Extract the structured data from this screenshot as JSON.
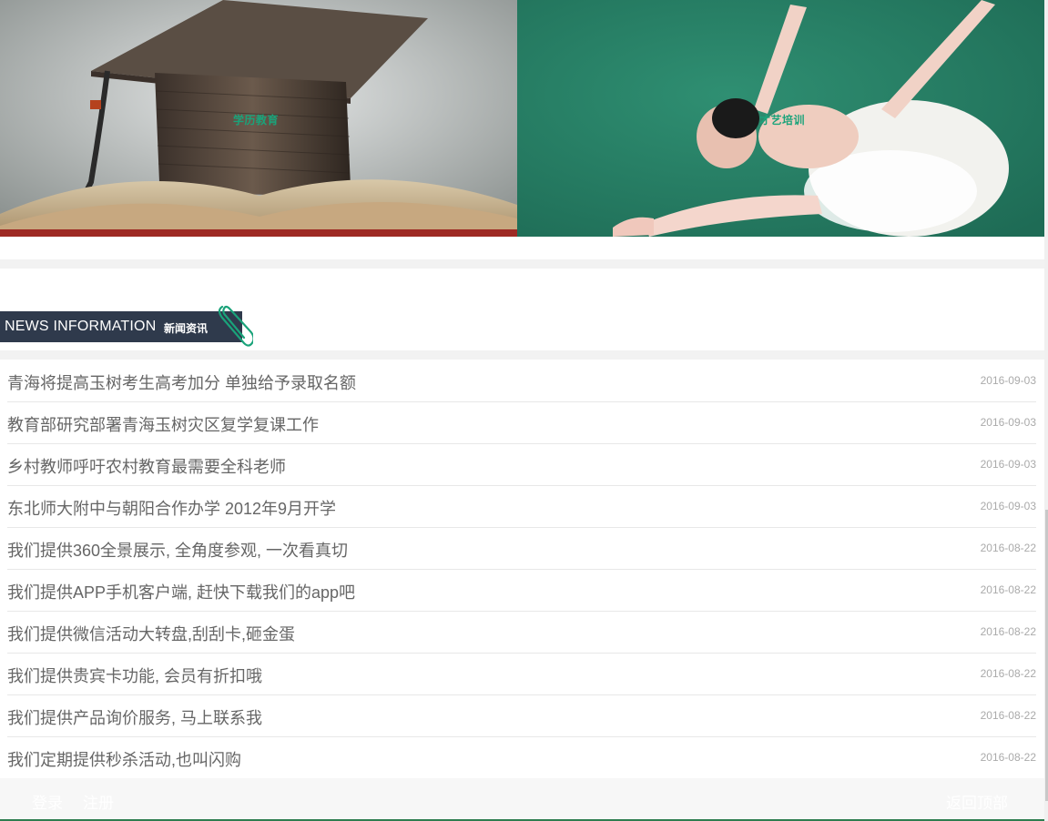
{
  "banners": [
    {
      "label": "学历教育",
      "image": "graduation-cap-on-book"
    },
    {
      "label": "才艺培训",
      "image": "ballet-dancer"
    }
  ],
  "section": {
    "title": "NEWS INFORMATION",
    "subtitle": "新闻资讯",
    "icon": "paperclip-icon",
    "accent": "#1aa37a",
    "header_bg": "#2f3a4c"
  },
  "news": [
    {
      "title": "青海将提高玉树考生高考加分 单独给予录取名额",
      "date": "2016-09-03"
    },
    {
      "title": "教育部研究部署青海玉树灾区复学复课工作",
      "date": "2016-09-03"
    },
    {
      "title": "乡村教师呼吁农村教育最需要全科老师",
      "date": "2016-09-03"
    },
    {
      "title": "东北师大附中与朝阳合作办学 2012年9月开学",
      "date": "2016-09-03"
    },
    {
      "title": "我们提供360全景展示, 全角度参观, 一次看真切",
      "date": "2016-08-22"
    },
    {
      "title": "我们提供APP手机客户端, 赶快下载我们的app吧",
      "date": "2016-08-22"
    },
    {
      "title": "我们提供微信活动大转盘,刮刮卡,砸金蛋",
      "date": "2016-08-22"
    },
    {
      "title": "我们提供贵宾卡功能, 会员有折扣哦",
      "date": "2016-08-22"
    },
    {
      "title": "我们提供产品询价服务, 马上联系我",
      "date": "2016-08-22"
    },
    {
      "title": "我们定期提供秒杀活动,也叫闪购",
      "date": "2016-08-22"
    }
  ],
  "footer": {
    "login": "登录",
    "register": "注册",
    "back_to_top": "返回顶部",
    "border_color": "#2e7d4f"
  }
}
